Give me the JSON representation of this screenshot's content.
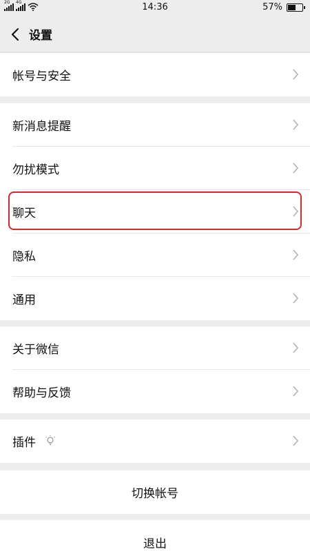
{
  "status_bar": {
    "signal1_label": "2G",
    "signal2_label": "4G",
    "time": "14:36",
    "battery_text": "57%",
    "battery_level": 0.57
  },
  "nav": {
    "title": "设置",
    "back_icon": "chevron-left-icon"
  },
  "groups": {
    "account": {
      "label": "帐号与安全"
    },
    "notifications": {
      "label": "新消息提醒"
    },
    "dnd": {
      "label": "勿扰模式"
    },
    "chat": {
      "label": "聊天"
    },
    "privacy": {
      "label": "隐私"
    },
    "general": {
      "label": "通用"
    },
    "about": {
      "label": "关于微信"
    },
    "help": {
      "label": "帮助与反馈"
    },
    "plugins": {
      "label": "插件",
      "icon": "plugin-bulb-icon"
    }
  },
  "actions": {
    "switch_account": "切换帐号",
    "logout": "退出"
  },
  "colors": {
    "background": "#ededed",
    "row": "#ffffff",
    "highlight": "#d9262b"
  }
}
